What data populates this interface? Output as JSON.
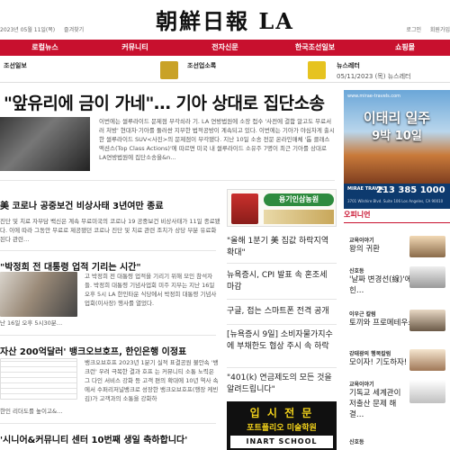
{
  "header": {
    "date": "2023년 05월 11일(목)",
    "bookmark": "즐겨찾기",
    "masthead": "朝鮮日報 LA",
    "login": "로그인",
    "signup": "회원가입"
  },
  "nav": [
    "로컬뉴스",
    "커뮤니티",
    "전자신문",
    "한국조선일보",
    "쇼핑몰"
  ],
  "strip": {
    "section1": "조선일보",
    "section2": "조선업소록",
    "newsletter": "뉴스레터",
    "newsletter_sub": "05/11/2023 (목) 뉴스레터"
  },
  "lead": {
    "headline": "\"앞유리에 금이 가네\"… 기아 상대로 집단소송",
    "body": "이번에는 썰루라이드 문제점 부각쇠라 기. LA 연방법원에 소장 접수 '사전에 결함 알고도 무료서 러 처방' 현대차·기아를 둘러싼 지부한 법적공방이 계속되고 있다. 이번에는 기아가 야심차게 출시한 썰루라이드 SUV<사진>의 문제점이 부각됐다. 지난 10일 소송 전문 온라인매체 '톱 클래스 액션스(Top Class Actions)'에 따르면 미국 내 썰루라이드 소유주 7명이 최근 기아를 상대로 LA연방법원에 집단소송을&n…"
  },
  "stories": [
    {
      "title": "美 코로나 공중보건 비상사태 3년여만 종료",
      "body": "진단 및 치료 자부담 백신은 계속 무료미국의 코로나 19 공중보건 비상사태가 11일 종료됐다. 이에 따라 그동안 무료로 제공됐던 코로나 진단 및 치료 관련 조치가 상당 부분 유료화된다 관련…"
    },
    {
      "title": "\"박정희 전 대통령 업적 기리는 시간\"",
      "body": "고 박정희 전 대통령 업적을 기리기 위해 모인 참석자들. 박정희 대통령 기념사업회 미주 지부는 지난 16일 오후 5시 LA 한인타운 식당에서 박정희 대통령 기념사업회(이사장) 행사를 열었다.",
      "caption": "난 16일 오후 5시30분…"
    },
    {
      "title": "자산 200억달러' 뱅크오브호프, 한인은행 이정표",
      "body": "뱅크오브호프 2023년 1분기 실적 표결공원 불안속 '뱅크런' 우려 극복한 결과 호프 는 커뮤니티 소통 노력은 그 다인 서비스 강화 등 고객 편의 확대에 10년 역사 속에서 수퍼리저널뱅크로 성장한 뱅크오브호프(행장 케빈 김)가 고객과의 소통을 강화하",
      "caption": "한인 리더도를 높이고&…"
    },
    {
      "title": "'시니어&커뮤니티 센터 10번째 생일 축하합니다'",
      "body": ""
    }
  ],
  "middle": [
    {
      "text": "\"올해 1분기 美 집값 하락지역 확대\""
    },
    {
      "text": "뉴욕증시, CPI 발표 속 혼조세 마감"
    },
    {
      "text": "구글, 접는 스마트폰 전격 공개"
    },
    {
      "text": "[뉴욕증시 9일] 소비자물가지수에 부채한도 협상 주시 속 하락"
    },
    {
      "text": "\"401(k) 연금제도의 모든 것을 알려드립니다\""
    }
  ],
  "ads": {
    "gold": "용기인삼농원",
    "tour_site": "www.mirae-travels.com",
    "tour_title": "이태리 일주",
    "tour_days": "9박 10일",
    "tour_phone": "213 385 1000",
    "tour_brand": "MIRAE TRAVEL",
    "tour_addr": "3701 Wilshire Blvd. Suite 106 Los Angeles, CA 90010",
    "art_title": "입 시 전 문",
    "art_sub": "포트폴리오 미술학원",
    "art_school": "INART SCHOOL"
  },
  "opinion": {
    "header": "오피니언",
    "items": [
      {
        "tag": "교육이야기",
        "title": "왕의 귀환"
      },
      {
        "tag": "신호등",
        "title": "'날짜 변경선(線)'에 얽힌…"
      },
      {
        "tag": "이우근 칼럼",
        "title": "토끼와 프로메테우스"
      },
      {
        "tag": "강태광의 행복칼럼",
        "title": "모이자! 기도하자!"
      },
      {
        "tag": "교육이야기",
        "title": "기독교 세계관이 저출산 문제 해결…"
      },
      {
        "tag": "신호등",
        "title": ""
      }
    ]
  }
}
